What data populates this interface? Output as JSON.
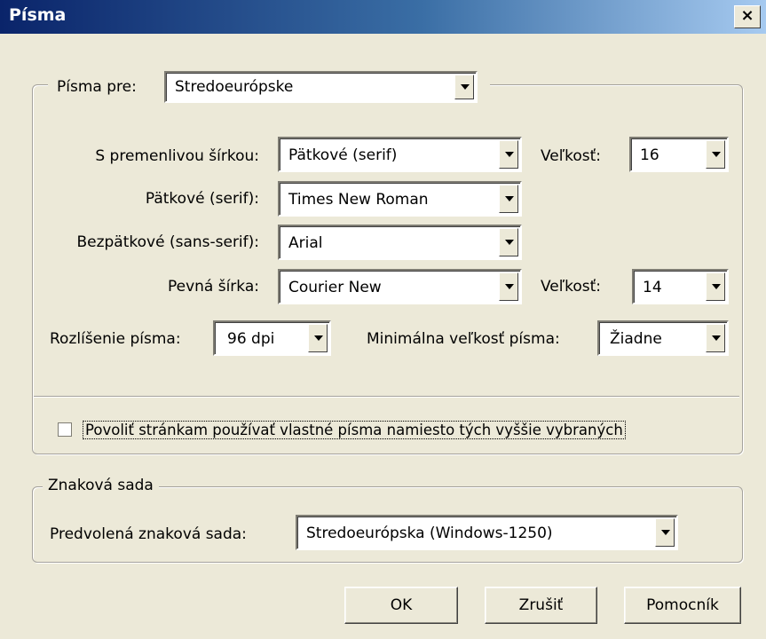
{
  "window": {
    "title": "Písma",
    "close_symbol": "×"
  },
  "fonts_group": {
    "legend_pre": "Písma pre:",
    "language": "Stredoeurópske",
    "proportional": {
      "label": "S premenlivou šírkou:",
      "value": "Pätkové (serif)"
    },
    "proportional_size": {
      "label": "Veľkosť:",
      "value": "16"
    },
    "serif": {
      "label": "Pätkové (serif):",
      "value": "Times New Roman"
    },
    "sans_serif": {
      "label": "Bezpätkové (sans-serif):",
      "value": "Arial"
    },
    "monospace": {
      "label": "Pevná šírka:",
      "value": "Courier New"
    },
    "monospace_size": {
      "label": "Veľkosť:",
      "value": "14"
    },
    "resolution": {
      "label": "Rozlíšenie písma:",
      "value": "96 dpi"
    },
    "min_size": {
      "label": "Minimálna veľkosť písma:",
      "value": "Žiadne"
    },
    "allow_pages": {
      "label": "Povoliť stránkam používať vlastné písma namiesto tých vyššie vybraných",
      "checked": false
    }
  },
  "charset_group": {
    "legend": "Znaková sada",
    "default_charset": {
      "label": "Predvolená znaková sada:",
      "value": "Stredoeurópska (Windows-1250)"
    }
  },
  "buttons": {
    "ok": "OK",
    "cancel": "Zrušiť",
    "help": "Pomocník"
  },
  "colors": {
    "dialog_bg": "#ece9d8",
    "title_start": "#0a246a",
    "title_end": "#a6caf0"
  }
}
